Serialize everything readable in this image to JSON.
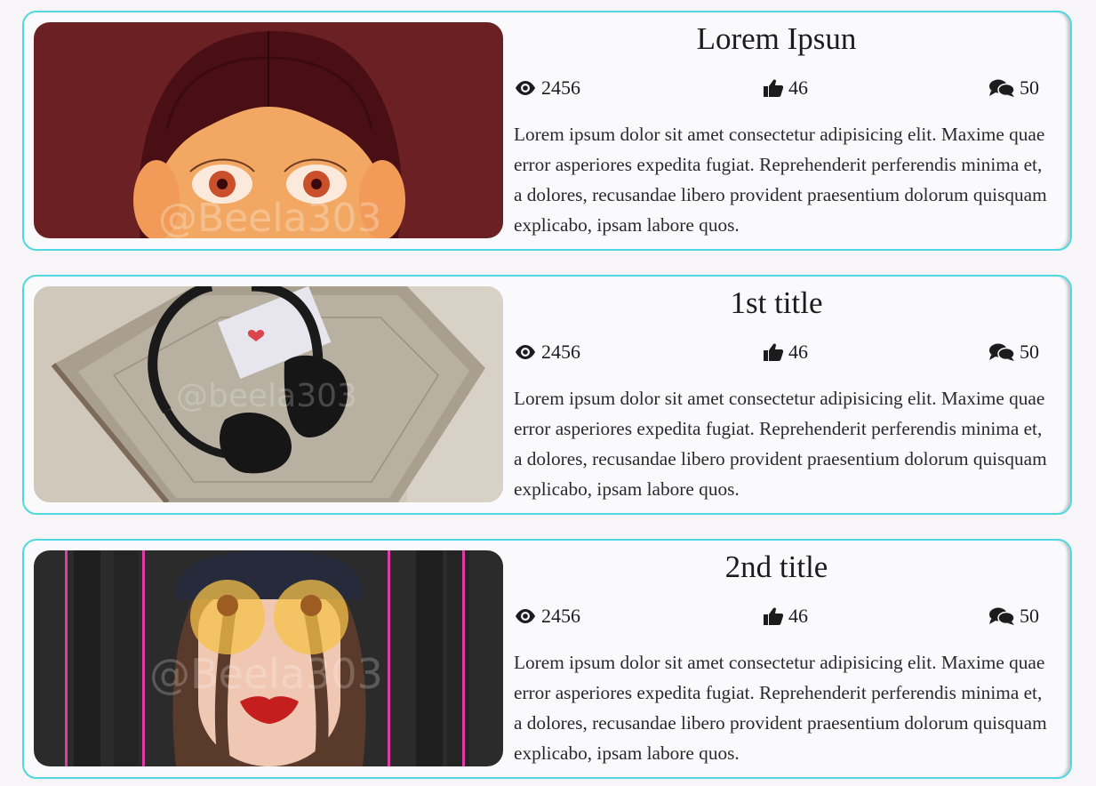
{
  "cards": [
    {
      "title": "Lorem Ipsun",
      "views": "2456",
      "likes": "46",
      "comments": "50",
      "text": "Lorem ipsum dolor sit amet consectetur adipisicing elit. Maxime quae error asperiores expedita fugiat. Reprehenderit perferendis minima et, a dolores, recusandae libero provident praesentium dolorum quisquam explicabo, ipsam labore quos.",
      "image_watermark": "@Beela303"
    },
    {
      "title": "1st title",
      "views": "2456",
      "likes": "46",
      "comments": "50",
      "text": "Lorem ipsum dolor sit amet consectetur adipisicing elit. Maxime quae error asperiores expedita fugiat. Reprehenderit perferendis minima et, a dolores, recusandae libero provident praesentium dolorum quisquam explicabo, ipsam labore quos.",
      "image_watermark": "@beela303"
    },
    {
      "title": "2nd title",
      "views": "2456",
      "likes": "46",
      "comments": "50",
      "text": "Lorem ipsum dolor sit amet consectetur adipisicing elit. Maxime quae error asperiores expedita fugiat. Reprehenderit perferendis minima et, a dolores, recusandae libero provident praesentium dolorum quisquam explicabo, ipsam labore quos.",
      "image_watermark": "@Beela303"
    }
  ],
  "icons": {
    "views": "eye-icon",
    "likes": "thumbs-up-icon",
    "comments": "comments-icon"
  },
  "colors": {
    "card_border": "#4fd9df",
    "background": "#f7f5f8",
    "text": "#1c1c1c"
  }
}
